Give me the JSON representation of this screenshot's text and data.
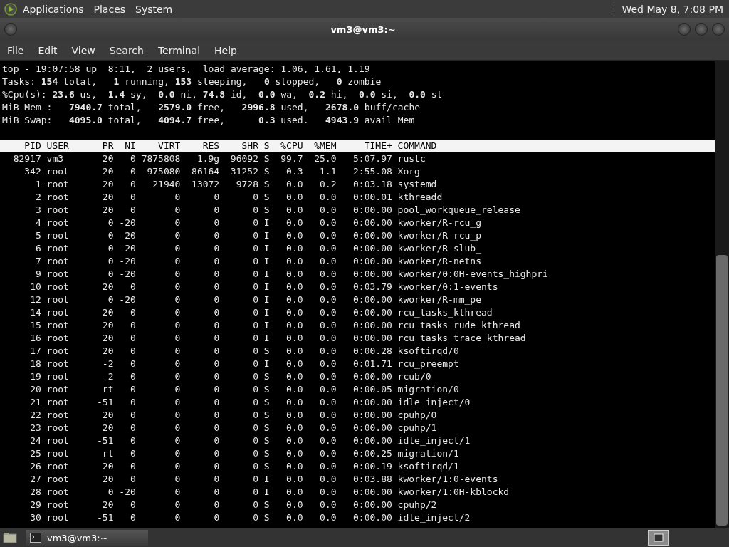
{
  "top_panel": {
    "menus": [
      "Applications",
      "Places",
      "System"
    ],
    "clock": "Wed May 8, 7:08 PM"
  },
  "window": {
    "title": "vm3@vm3:~"
  },
  "menubar": [
    "File",
    "Edit",
    "View",
    "Search",
    "Terminal",
    "Help"
  ],
  "summary": [
    "top - 19:07:58 up  8:11,  2 users,  load average: 1.06, 1.61, 1.19",
    "Tasks: **154** total,   **1** running, **153** sleeping,   **0** stopped,   **0** zombie",
    "%Cpu(s): **23.6** us,  **1.4** sy,  **0.0** ni, **74.8** id,  **0.0** wa,  **0.2** hi,  **0.0** si,  **0.0** st",
    "MiB Mem :   **7940.7** total,   **2579.0** free,   **2996.8** used,   **2678.0** buff/cache",
    "MiB Swap:   **4095.0** total,   **4094.7** free,      **0.3** used.   **4943.9** avail Mem"
  ],
  "table": {
    "columns": [
      "PID",
      "USER",
      "PR",
      "NI",
      "VIRT",
      "RES",
      "SHR",
      "S",
      "%CPU",
      "%MEM",
      "TIME+",
      "COMMAND"
    ],
    "rows": [
      [
        "82917",
        "vm3",
        "20",
        "0",
        "7875808",
        "1.9g",
        "96092",
        "S",
        "99.7",
        "25.0",
        "5:07.97",
        "rustc"
      ],
      [
        "342",
        "root",
        "20",
        "0",
        "975080",
        "86164",
        "31252",
        "S",
        "0.3",
        "1.1",
        "2:55.08",
        "Xorg"
      ],
      [
        "1",
        "root",
        "20",
        "0",
        "21940",
        "13072",
        "9728",
        "S",
        "0.0",
        "0.2",
        "0:03.18",
        "systemd"
      ],
      [
        "2",
        "root",
        "20",
        "0",
        "0",
        "0",
        "0",
        "S",
        "0.0",
        "0.0",
        "0:00.01",
        "kthreadd"
      ],
      [
        "3",
        "root",
        "20",
        "0",
        "0",
        "0",
        "0",
        "S",
        "0.0",
        "0.0",
        "0:00.00",
        "pool_workqueue_release"
      ],
      [
        "4",
        "root",
        "0",
        "-20",
        "0",
        "0",
        "0",
        "I",
        "0.0",
        "0.0",
        "0:00.00",
        "kworker/R-rcu_g"
      ],
      [
        "5",
        "root",
        "0",
        "-20",
        "0",
        "0",
        "0",
        "I",
        "0.0",
        "0.0",
        "0:00.00",
        "kworker/R-rcu_p"
      ],
      [
        "6",
        "root",
        "0",
        "-20",
        "0",
        "0",
        "0",
        "I",
        "0.0",
        "0.0",
        "0:00.00",
        "kworker/R-slub_"
      ],
      [
        "7",
        "root",
        "0",
        "-20",
        "0",
        "0",
        "0",
        "I",
        "0.0",
        "0.0",
        "0:00.00",
        "kworker/R-netns"
      ],
      [
        "9",
        "root",
        "0",
        "-20",
        "0",
        "0",
        "0",
        "I",
        "0.0",
        "0.0",
        "0:00.00",
        "kworker/0:0H-events_highpri"
      ],
      [
        "10",
        "root",
        "20",
        "0",
        "0",
        "0",
        "0",
        "I",
        "0.0",
        "0.0",
        "0:03.79",
        "kworker/0:1-events"
      ],
      [
        "12",
        "root",
        "0",
        "-20",
        "0",
        "0",
        "0",
        "I",
        "0.0",
        "0.0",
        "0:00.00",
        "kworker/R-mm_pe"
      ],
      [
        "14",
        "root",
        "20",
        "0",
        "0",
        "0",
        "0",
        "I",
        "0.0",
        "0.0",
        "0:00.00",
        "rcu_tasks_kthread"
      ],
      [
        "15",
        "root",
        "20",
        "0",
        "0",
        "0",
        "0",
        "I",
        "0.0",
        "0.0",
        "0:00.00",
        "rcu_tasks_rude_kthread"
      ],
      [
        "16",
        "root",
        "20",
        "0",
        "0",
        "0",
        "0",
        "I",
        "0.0",
        "0.0",
        "0:00.00",
        "rcu_tasks_trace_kthread"
      ],
      [
        "17",
        "root",
        "20",
        "0",
        "0",
        "0",
        "0",
        "S",
        "0.0",
        "0.0",
        "0:00.28",
        "ksoftirqd/0"
      ],
      [
        "18",
        "root",
        "-2",
        "0",
        "0",
        "0",
        "0",
        "I",
        "0.0",
        "0.0",
        "0:01.71",
        "rcu_preempt"
      ],
      [
        "19",
        "root",
        "-2",
        "0",
        "0",
        "0",
        "0",
        "S",
        "0.0",
        "0.0",
        "0:00.00",
        "rcub/0"
      ],
      [
        "20",
        "root",
        "rt",
        "0",
        "0",
        "0",
        "0",
        "S",
        "0.0",
        "0.0",
        "0:00.05",
        "migration/0"
      ],
      [
        "21",
        "root",
        "-51",
        "0",
        "0",
        "0",
        "0",
        "S",
        "0.0",
        "0.0",
        "0:00.00",
        "idle_inject/0"
      ],
      [
        "22",
        "root",
        "20",
        "0",
        "0",
        "0",
        "0",
        "S",
        "0.0",
        "0.0",
        "0:00.00",
        "cpuhp/0"
      ],
      [
        "23",
        "root",
        "20",
        "0",
        "0",
        "0",
        "0",
        "S",
        "0.0",
        "0.0",
        "0:00.00",
        "cpuhp/1"
      ],
      [
        "24",
        "root",
        "-51",
        "0",
        "0",
        "0",
        "0",
        "S",
        "0.0",
        "0.0",
        "0:00.00",
        "idle_inject/1"
      ],
      [
        "25",
        "root",
        "rt",
        "0",
        "0",
        "0",
        "0",
        "S",
        "0.0",
        "0.0",
        "0:00.25",
        "migration/1"
      ],
      [
        "26",
        "root",
        "20",
        "0",
        "0",
        "0",
        "0",
        "S",
        "0.0",
        "0.0",
        "0:00.19",
        "ksoftirqd/1"
      ],
      [
        "27",
        "root",
        "20",
        "0",
        "0",
        "0",
        "0",
        "I",
        "0.0",
        "0.0",
        "0:03.88",
        "kworker/1:0-events"
      ],
      [
        "28",
        "root",
        "0",
        "-20",
        "0",
        "0",
        "0",
        "I",
        "0.0",
        "0.0",
        "0:00.00",
        "kworker/1:0H-kblockd"
      ],
      [
        "29",
        "root",
        "20",
        "0",
        "0",
        "0",
        "0",
        "S",
        "0.0",
        "0.0",
        "0:00.00",
        "cpuhp/2"
      ],
      [
        "30",
        "root",
        "-51",
        "0",
        "0",
        "0",
        "0",
        "S",
        "0.0",
        "0.0",
        "0:00.00",
        "idle_inject/2"
      ]
    ]
  },
  "taskbar": {
    "tasks": [
      {
        "label": "vm3@vm3:~",
        "selected": true
      }
    ]
  }
}
